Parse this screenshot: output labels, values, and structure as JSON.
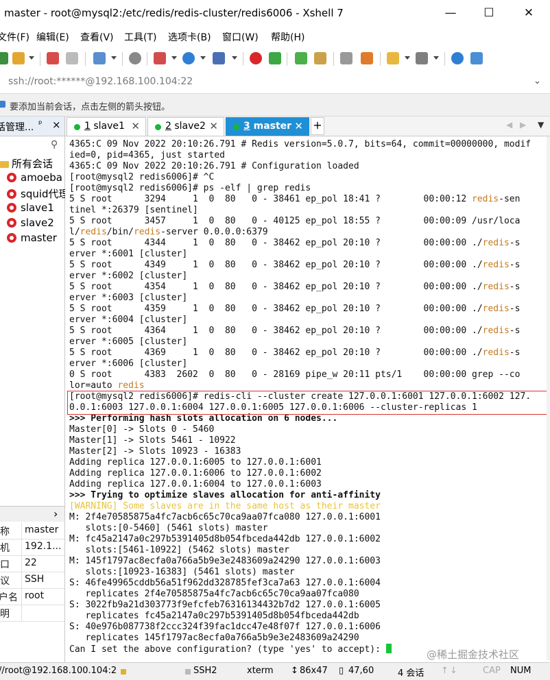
{
  "window": {
    "title": "master - root@mysql2:/etc/redis/redis-cluster/redis6006 - Xshell 7",
    "minimize": "—",
    "maximize": "☐",
    "close": "✕"
  },
  "menu": [
    "文件(F)",
    "编辑(E)",
    "查看(V)",
    "工具(T)",
    "选项卡(B)",
    "窗口(W)",
    "帮助(H)"
  ],
  "address": "ssh://root:******@192.168.100.104:22",
  "hint": "要添加当前会话，点击左侧的箭头按钮。",
  "session_panel": {
    "header": "话管理...",
    "pin": "ᵖ",
    "close": "×",
    "root_folder": "所有会话",
    "sessions": [
      "amoeba",
      "squid代理",
      "slave1",
      "slave2",
      "master"
    ],
    "expand": "›",
    "properties": [
      {
        "key": "称",
        "value": "master"
      },
      {
        "key": "机",
        "value": "192.1..."
      },
      {
        "key": "口",
        "value": "22"
      },
      {
        "key": "议",
        "value": "SSH"
      },
      {
        "key": "户名",
        "value": "root"
      },
      {
        "key": "明",
        "value": ""
      }
    ]
  },
  "tabs": [
    {
      "num": "1",
      "label": " slave1"
    },
    {
      "num": "2",
      "label": " slave2"
    },
    {
      "num": "3",
      "label": " master"
    }
  ],
  "tab_add": "+",
  "terminal": {
    "lines": [
      [
        {
          "t": "4365:C 09 Nov 2022 20:10:26.791 # Redis version=5.0.7, bits=64, commit=00000000, modif"
        }
      ],
      [
        {
          "t": "ied=0, pid=4365, just started"
        }
      ],
      [
        {
          "t": "4365:C 09 Nov 2022 20:10:26.791 # Configuration loaded"
        }
      ],
      [
        {
          "t": "[root@mysql2 redis6006]# ^C"
        }
      ],
      [
        {
          "t": "[root@mysql2 redis6006]# ps -elf | grep redis"
        }
      ],
      [
        {
          "t": "5 S root      3294     1  0  80   0 - 38461 ep_pol 18:41 ?        00:00:12 "
        },
        {
          "t": "redis",
          "c": "hl"
        },
        {
          "t": "-sen"
        }
      ],
      [
        {
          "t": "tinel *:26379 [sentinel]"
        }
      ],
      [
        {
          "t": "5 S root      3457     1  0  80   0 - 40125 ep_pol 18:55 ?        00:00:09 /usr/loca"
        }
      ],
      [
        {
          "t": "l/"
        },
        {
          "t": "redis",
          "c": "hl"
        },
        {
          "t": "/bin/"
        },
        {
          "t": "redis",
          "c": "hl"
        },
        {
          "t": "-server 0.0.0.0:6379"
        }
      ],
      [
        {
          "t": "5 S root      4344     1  0  80   0 - 38462 ep_pol 20:10 ?        00:00:00 ./"
        },
        {
          "t": "redis",
          "c": "hl"
        },
        {
          "t": "-s"
        }
      ],
      [
        {
          "t": "erver *:6001 [cluster]"
        }
      ],
      [
        {
          "t": "5 S root      4349     1  0  80   0 - 38462 ep_pol 20:10 ?        00:00:00 ./"
        },
        {
          "t": "redis",
          "c": "hl"
        },
        {
          "t": "-s"
        }
      ],
      [
        {
          "t": "erver *:6002 [cluster]"
        }
      ],
      [
        {
          "t": "5 S root      4354     1  0  80   0 - 38462 ep_pol 20:10 ?        00:00:00 ./"
        },
        {
          "t": "redis",
          "c": "hl"
        },
        {
          "t": "-s"
        }
      ],
      [
        {
          "t": "erver *:6003 [cluster]"
        }
      ],
      [
        {
          "t": "5 S root      4359     1  0  80   0 - 38462 ep_pol 20:10 ?        00:00:00 ./"
        },
        {
          "t": "redis",
          "c": "hl"
        },
        {
          "t": "-s"
        }
      ],
      [
        {
          "t": "erver *:6004 [cluster]"
        }
      ],
      [
        {
          "t": "5 S root      4364     1  0  80   0 - 38462 ep_pol 20:10 ?        00:00:00 ./"
        },
        {
          "t": "redis",
          "c": "hl"
        },
        {
          "t": "-s"
        }
      ],
      [
        {
          "t": "erver *:6005 [cluster]"
        }
      ],
      [
        {
          "t": "5 S root      4369     1  0  80   0 - 38462 ep_pol 20:10 ?        00:00:00 ./"
        },
        {
          "t": "redis",
          "c": "hl"
        },
        {
          "t": "-s"
        }
      ],
      [
        {
          "t": "erver *:6006 [cluster]"
        }
      ],
      [
        {
          "t": "0 S root      4383  2602  0  80   0 - 28169 pipe_w 20:11 pts/1    00:00:00 grep --co"
        }
      ],
      [
        {
          "t": "lor=auto "
        },
        {
          "t": "redis",
          "c": "hl"
        }
      ],
      [
        {
          "t": "[root@mysql2 redis6006]# redis-cli --cluster create 127.0.0.1:6001 127.0.0.1:6002 127."
        }
      ],
      [
        {
          "t": "0.0.1:6003 127.0.0.1:6004 127.0.0.1:6005 127.0.0.1:6006 --cluster-replicas 1"
        }
      ],
      [
        {
          "t": ">>> Performing hash slots allocation on 6 nodes...",
          "c": "b"
        }
      ],
      [
        {
          "t": "Master[0] -> Slots 0 - 5460"
        }
      ],
      [
        {
          "t": "Master[1] -> Slots 5461 - 10922"
        }
      ],
      [
        {
          "t": "Master[2] -> Slots 10923 - 16383"
        }
      ],
      [
        {
          "t": "Adding replica 127.0.0.1:6005 to 127.0.0.1:6001"
        }
      ],
      [
        {
          "t": "Adding replica 127.0.0.1:6006 to 127.0.0.1:6002"
        }
      ],
      [
        {
          "t": "Adding replica 127.0.0.1:6004 to 127.0.0.1:6003"
        }
      ],
      [
        {
          "t": ">>> Trying to optimize slaves allocation for anti-affinity",
          "c": "b"
        }
      ],
      [
        {
          "t": "[WARNING] Some slaves are in the same host as their master",
          "c": "warn"
        }
      ],
      [
        {
          "t": "M: 2f4e70585875a4fc7acb6c65c70ca9aa07fca080 127.0.0.1:6001"
        }
      ],
      [
        {
          "t": "   slots:[0-5460] (5461 slots) master"
        }
      ],
      [
        {
          "t": "M: fc45a2147a0c297b5391405d8b054fbceda442db 127.0.0.1:6002"
        }
      ],
      [
        {
          "t": "   slots:[5461-10922] (5462 slots) master"
        }
      ],
      [
        {
          "t": "M: 145f1797ac8ecfa0a766a5b9e3e2483609a24290 127.0.0.1:6003"
        }
      ],
      [
        {
          "t": "   slots:[10923-16383] (5461 slots) master"
        }
      ],
      [
        {
          "t": "S: 46fe49965cddb56a51f962dd328785fef3ca7a63 127.0.0.1:6004"
        }
      ],
      [
        {
          "t": "   replicates 2f4e70585875a4fc7acb6c65c70ca9aa07fca080"
        }
      ],
      [
        {
          "t": "S: 3022fb9a21d303773f9efcfeb76316134432b7d2 127.0.0.1:6005"
        }
      ],
      [
        {
          "t": "   replicates fc45a2147a0c297b5391405d8b054fbceda442db"
        }
      ],
      [
        {
          "t": "S: 40e976b087738f2ccc324f39fac1dcc47e48f07f 127.0.0.1:6006"
        }
      ],
      [
        {
          "t": "   replicates 145f1797ac8ecfa0a766a5b9e3e2483609a24290"
        }
      ],
      [
        {
          "t": "Can I set the above configuration? (type 'yes' to accept): "
        }
      ]
    ]
  },
  "watermark": "@稀土掘金技术社区",
  "status": {
    "connection": "//root@192.168.100.104:2",
    "protocol": "SSH2",
    "term": "xterm",
    "size": "86x47",
    "cursor_pos": "47,60",
    "sessions": "4 会话",
    "cap": "CAP",
    "num": "NUM"
  },
  "colors": {
    "accent_tab": "#1f8fd6",
    "session_dot": "#19b53b",
    "highlight": "#c47a1e",
    "warning": "#e9c33a",
    "cursor": "#19c43a",
    "command_box": "#d9322e"
  }
}
